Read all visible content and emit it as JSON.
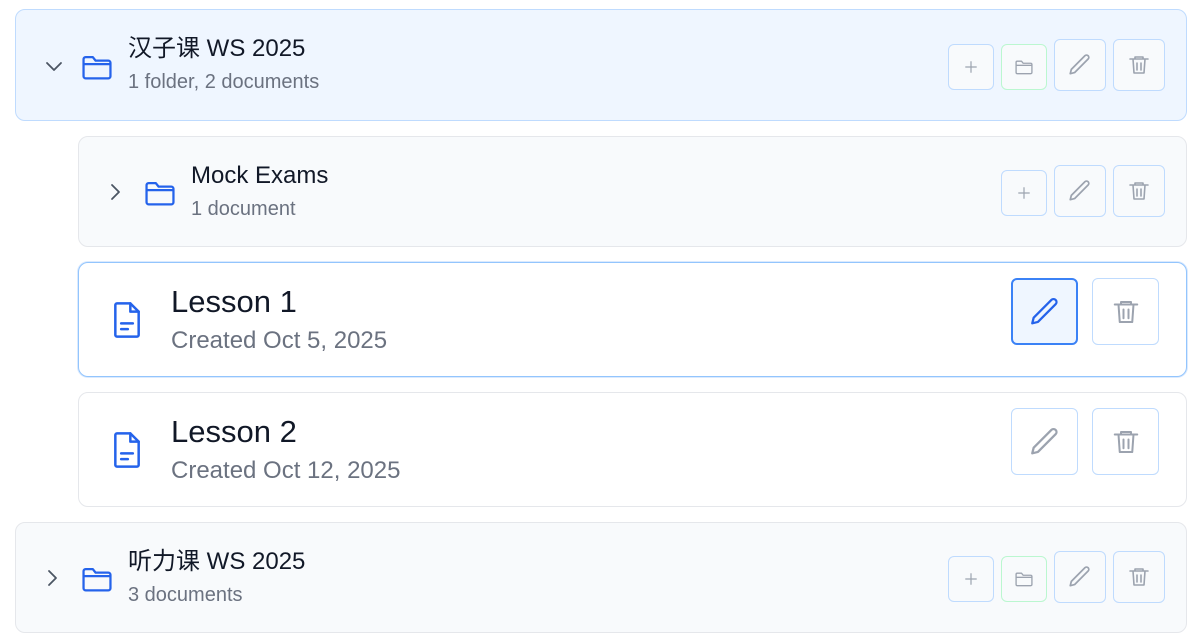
{
  "items": [
    {
      "type": "folder",
      "name": "汉子课 WS 2025",
      "meta": "1 folder, 2 documents",
      "expanded": true
    },
    {
      "type": "folder",
      "name": "Mock Exams",
      "meta": "1 document",
      "expanded": false
    },
    {
      "type": "document",
      "name": "Lesson 1",
      "meta": "Created Oct 5, 2025",
      "active": true
    },
    {
      "type": "document",
      "name": "Lesson 2",
      "meta": "Created Oct 12, 2025",
      "active": false
    },
    {
      "type": "folder",
      "name": "听力课 WS 2025",
      "meta": "3 documents",
      "expanded": false
    }
  ],
  "icons": {
    "expand": "chevron-down-icon",
    "collapse": "chevron-right-icon",
    "folder": "folder-icon",
    "document": "document-icon",
    "add": "plus-icon",
    "add_folder": "folder-plus-icon",
    "edit": "pencil-icon",
    "delete": "trash-icon"
  },
  "colors": {
    "accent": "#2563eb",
    "expanded_folder_bg": "#eff6ff",
    "add_folder_border": "#bbf7d0",
    "button_border": "#bfdbfe"
  }
}
